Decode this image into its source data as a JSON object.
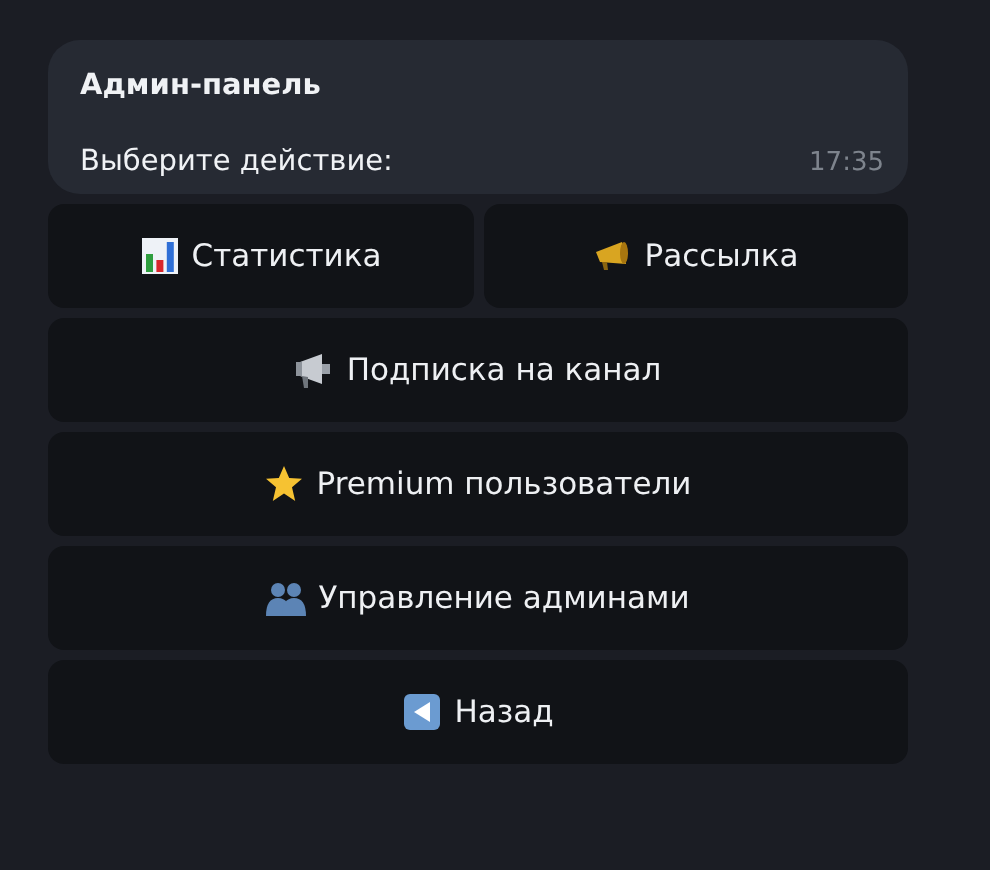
{
  "message": {
    "title": "Админ-панель",
    "text": "Выберите действие:",
    "time": "17:35"
  },
  "keyboard": [
    [
      {
        "label": "Статистика",
        "kind": "chart"
      },
      {
        "label": "Рассылка",
        "kind": "megaphone"
      }
    ],
    [
      {
        "label": "Подписка на канал",
        "kind": "loudspeaker"
      }
    ],
    [
      {
        "label": "Premium пользователи",
        "kind": "star"
      }
    ],
    [
      {
        "label": "Управление админами",
        "kind": "people"
      }
    ],
    [
      {
        "label": "Назад",
        "kind": "back"
      }
    ]
  ]
}
